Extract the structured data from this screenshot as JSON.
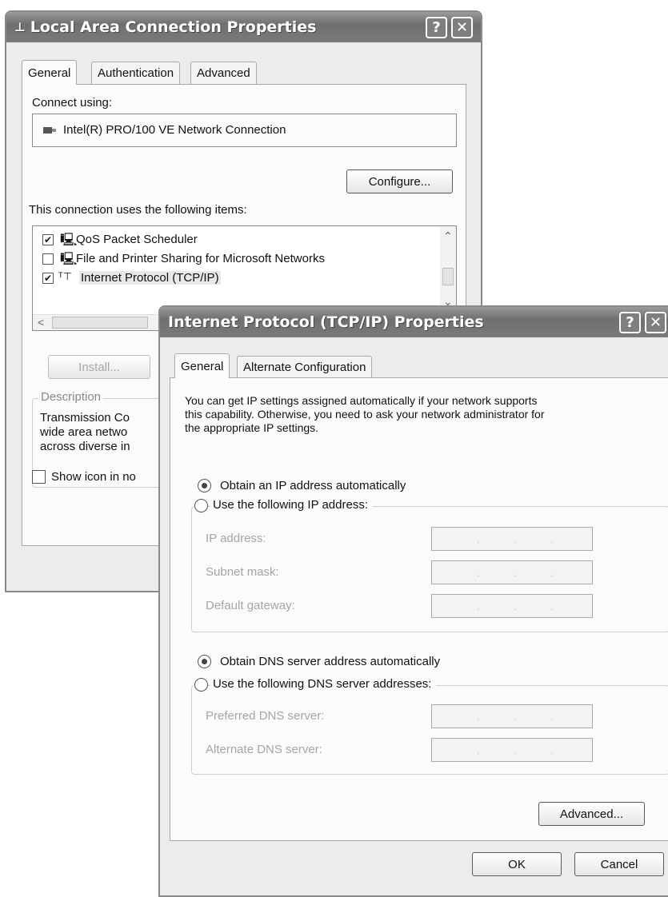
{
  "lan_dialog": {
    "title": "Local Area Connection Properties",
    "help_glyph": "?",
    "close_glyph": "✕",
    "tabs": [
      "General",
      "Authentication",
      "Advanced"
    ],
    "connect_using_label": "Connect using:",
    "adapter_name": "Intel(R) PRO/100 VE Network Connection",
    "configure_button": "Configure...",
    "items_label": "This connection uses the following items:",
    "items": [
      {
        "label": "QoS Packet Scheduler",
        "checked": true
      },
      {
        "label": "File and Printer Sharing for Microsoft Networks",
        "checked": false
      },
      {
        "label": "Internet Protocol (TCP/IP)",
        "checked": true
      }
    ],
    "install_button": "Install...",
    "description_label": "Description",
    "description_lines": [
      "Transmission Co",
      "wide area netwo",
      "across diverse in"
    ],
    "show_icon_label": "Show icon in no",
    "check_glyph": "✔",
    "scroll_up_glyph": "⌃",
    "scroll_down_glyph": "⌄",
    "scroll_left_glyph": "<"
  },
  "tcp_dialog": {
    "title": "Internet Protocol (TCP/IP) Properties",
    "help_glyph": "?",
    "close_glyph": "✕",
    "tabs": [
      "General",
      "Alternate Configuration"
    ],
    "intro_lines": [
      "You can get IP settings assigned automatically if your network supports",
      "this capability. Otherwise, you need to ask your network administrator for",
      "the appropriate IP settings."
    ],
    "obtain_ip_auto": "Obtain an IP address automatically",
    "use_following_ip": "Use the following IP address:",
    "ip_address_label": "IP address:",
    "subnet_mask_label": "Subnet mask:",
    "default_gateway_label": "Default gateway:",
    "obtain_dns_auto": "Obtain DNS server address automatically",
    "use_following_dns": "Use the following DNS server addresses:",
    "preferred_dns_label": "Preferred DNS server:",
    "alternate_dns_label": "Alternate DNS server:",
    "ip_dot": ".",
    "advanced_button": "Advanced...",
    "ok_button": "OK",
    "cancel_button": "Cancel"
  }
}
